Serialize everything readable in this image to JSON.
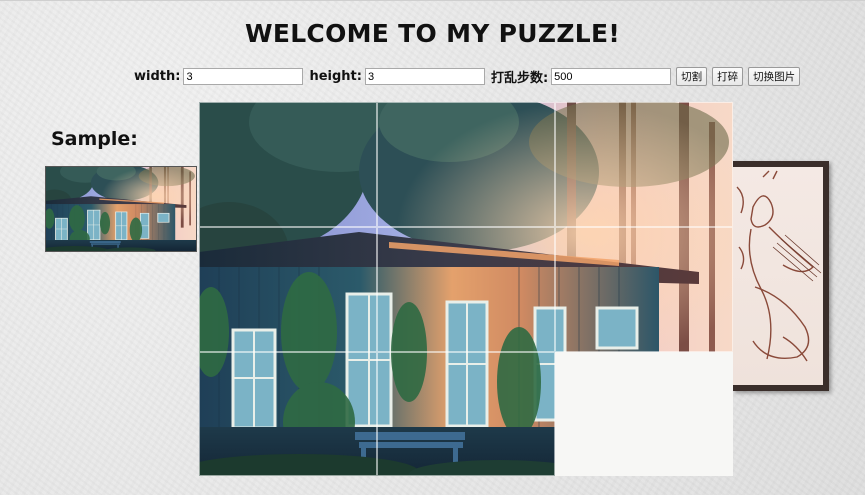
{
  "page": {
    "title": "WELCOME TO MY PUZZLE!"
  },
  "controls": {
    "width_label": "width:",
    "width_value": "3",
    "height_label": "height:",
    "height_value": "3",
    "steps_label": "打乱步数:",
    "steps_value": "500",
    "cut_button": "切割",
    "shuffle_button": "打碎",
    "switch_image_button": "切换图片"
  },
  "sample": {
    "label": "Sample:"
  },
  "puzzle": {
    "rows": 3,
    "cols": 3,
    "empty_tile": "row 3, col 3"
  }
}
